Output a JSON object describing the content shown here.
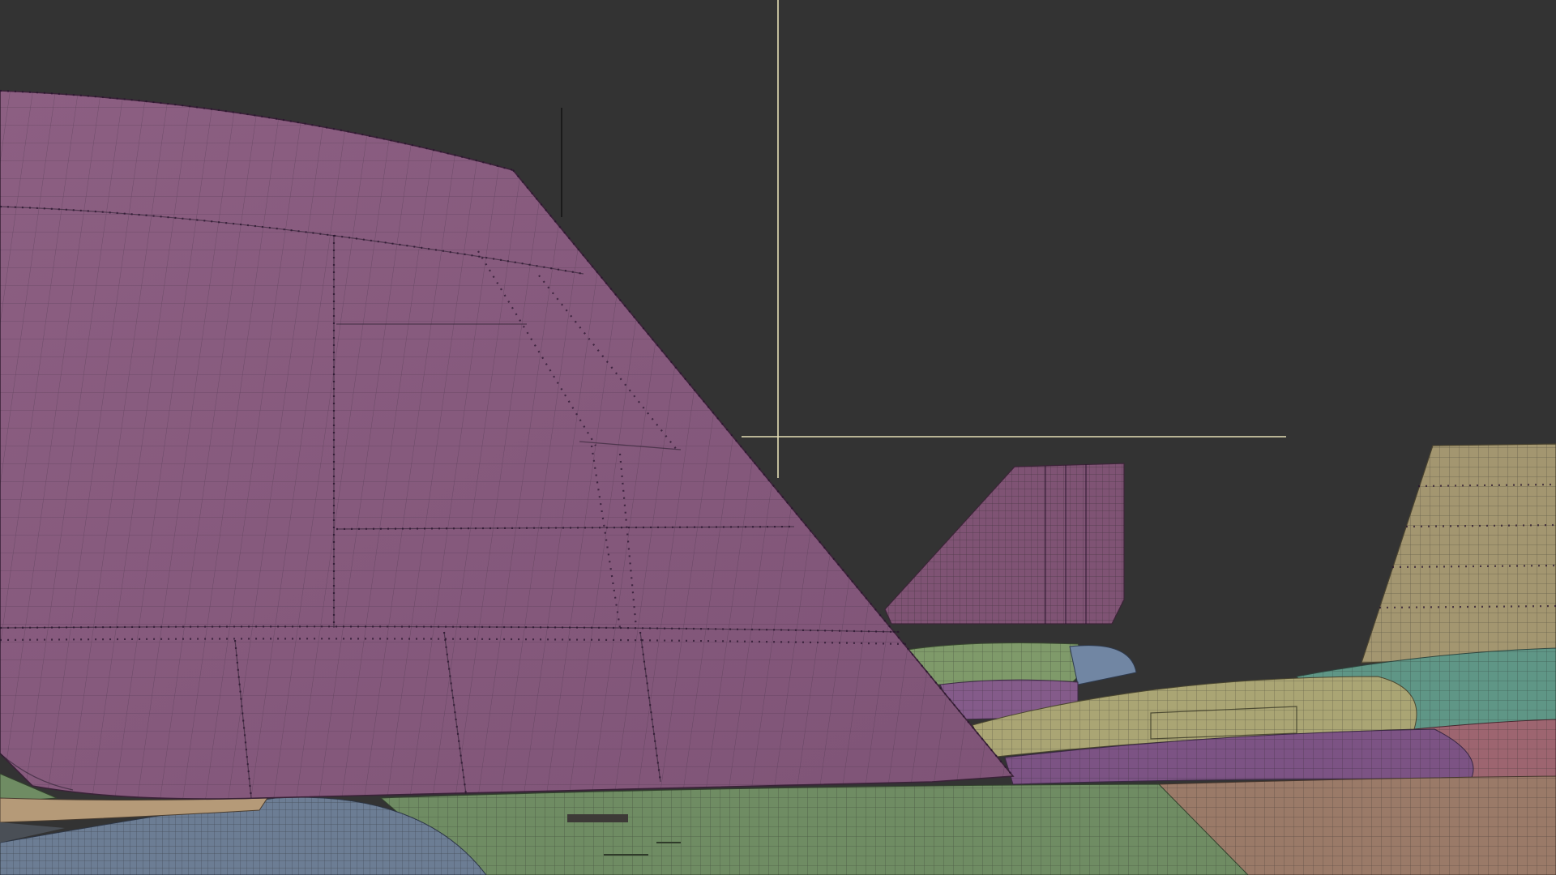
{
  "viewport": {
    "background": "#333333",
    "shading_mode": "wireframe-over-shaded",
    "model_colors": {
      "vertical_stabilizer_near": "#875a7d",
      "vertical_stabilizer_far": "#7d5273",
      "vertical_stabilizer_right": "#9c8e65",
      "nacelle_green": "#6e8c63",
      "nacelle_blue": "#6c7d94",
      "fuselage_khaki": "#a8a474",
      "fuselage_purple": "#7f5883",
      "fuselage_teal": "#5f9686",
      "fuselage_tan": "#9c7b6a",
      "fuselage_rose": "#9d6570"
    },
    "crosshair_color": "#e6e0b6"
  }
}
